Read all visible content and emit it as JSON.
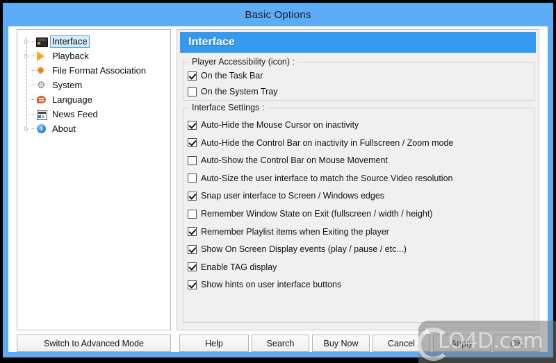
{
  "window": {
    "title": "Basic Options",
    "accent_color": "#5cadf5",
    "header_color": "#3699f0"
  },
  "sidebar": {
    "items": [
      {
        "label": "Interface",
        "icon": "monitor-icon",
        "expandable": true,
        "selected": true
      },
      {
        "label": "Playback",
        "icon": "play-icon",
        "expandable": true,
        "selected": false
      },
      {
        "label": "File Format Association",
        "icon": "association-icon",
        "expandable": false,
        "selected": false
      },
      {
        "label": "System",
        "icon": "gear-icon",
        "expandable": false,
        "selected": false
      },
      {
        "label": "Language",
        "icon": "speech-bubble-icon",
        "expandable": false,
        "selected": false
      },
      {
        "label": "News Feed",
        "icon": "news-icon",
        "expandable": false,
        "selected": false
      },
      {
        "label": "About",
        "icon": "info-icon",
        "expandable": true,
        "selected": false
      }
    ]
  },
  "main": {
    "section_title": "Interface",
    "groups": [
      {
        "title": "Player Accessibility (icon) :",
        "options": [
          {
            "label": "On the Task Bar",
            "checked": true
          },
          {
            "label": "On the System Tray",
            "checked": false
          }
        ]
      },
      {
        "title": "Interface Settings :",
        "options": [
          {
            "label": "Auto-Hide the Mouse Cursor on inactivity",
            "checked": true
          },
          {
            "label": "Auto-Hide the Control Bar on inactivity in Fullscreen / Zoom mode",
            "checked": true
          },
          {
            "label": "Auto-Show the Control Bar on Mouse Movement",
            "checked": false
          },
          {
            "label": "Auto-Size the user interface to match the Source Video resolution",
            "checked": false
          },
          {
            "label": "Snap user interface to Screen / Windows edges",
            "checked": true
          },
          {
            "label": "Remember Window State on Exit (fullscreen / width / height)",
            "checked": false
          },
          {
            "label": "Remember Playlist items when Exiting the player",
            "checked": true
          },
          {
            "label": "Show On Screen Display events (play / pause / etc...)",
            "checked": true
          },
          {
            "label": "Enable TAG display",
            "checked": true
          },
          {
            "label": "Show hints on user interface buttons",
            "checked": true
          }
        ]
      }
    ]
  },
  "footer": {
    "advanced": "Switch to Advanced Mode",
    "help": "Help",
    "search": "Search",
    "buy_now": "Buy Now",
    "cancel": "Cancel",
    "apply": "Apply",
    "ok": "OK"
  },
  "watermark": {
    "text": "LO4D.com"
  }
}
